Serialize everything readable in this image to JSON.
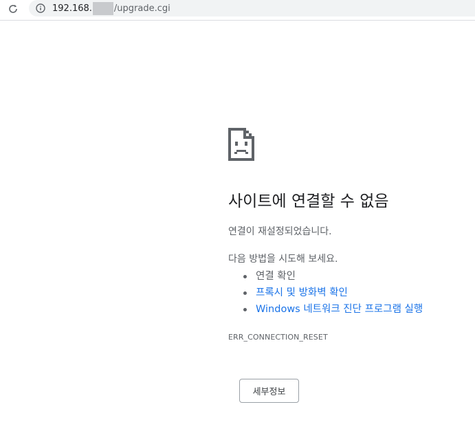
{
  "browser": {
    "reload_icon": "reload-icon",
    "info_icon": "info-icon",
    "url_prefix": "192.168.",
    "url_suffix": "/upgrade.cgi"
  },
  "error_page": {
    "icon": "sad-page-icon",
    "title": "사이트에 연결할 수 없음",
    "description": "연결이 재설정되었습니다.",
    "suggestions_heading": "다음 방법을 시도해 보세요.",
    "suggestions": [
      {
        "label": "연결 확인",
        "link": false
      },
      {
        "label": "프록시 및 방화벽 확인",
        "link": true
      },
      {
        "label": "Windows 네트워크 진단 프로그램 실행",
        "link": true
      }
    ],
    "error_code": "ERR_CONNECTION_RESET",
    "details_button": "세부정보"
  },
  "colors": {
    "link": "#1a73e8",
    "text_secondary": "#5f6368",
    "omnibox_bg": "#f1f3f4"
  }
}
